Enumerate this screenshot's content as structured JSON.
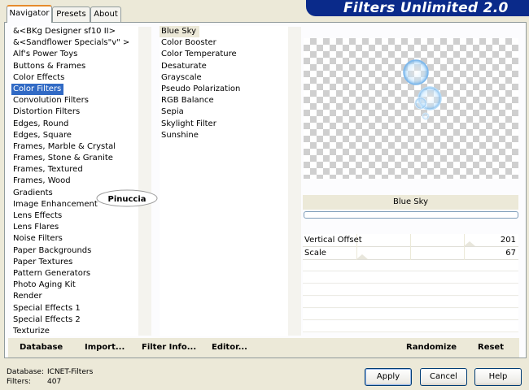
{
  "window": {
    "title": "Filters Unlimited 2.0"
  },
  "tabs": [
    {
      "label": "Navigator"
    },
    {
      "label": "Presets"
    },
    {
      "label": "About"
    }
  ],
  "categories": [
    "&<BKg Designer sf10 II>",
    "&<Sandflower Specials\"v\" >",
    "Alf's Power Toys",
    "Buttons & Frames",
    "Color Effects",
    "Color Filters",
    "Convolution Filters",
    "Distortion Filters",
    "Edges, Round",
    "Edges, Square",
    "Frames, Marble & Crystal",
    "Frames, Stone & Granite",
    "Frames, Textured",
    "Frames, Wood",
    "Gradients",
    "Image Enhancement",
    "Lens Effects",
    "Lens Flares",
    "Noise Filters",
    "Paper Backgrounds",
    "Paper Textures",
    "Pattern Generators",
    "Photo Aging Kit",
    "Render",
    "Special Effects 1",
    "Special Effects 2",
    "Texturize"
  ],
  "selected_category": "Color Filters",
  "filters": [
    "Blue Sky",
    "Color Booster",
    "Color Temperature",
    "Desaturate",
    "Grayscale",
    "Pseudo Polarization",
    "RGB Balance",
    "Sepia",
    "Skylight Filter",
    "Sunshine"
  ],
  "selected_filter": "Blue Sky",
  "watermark": "Pinuccia",
  "filter_title": "Blue Sky",
  "parameters": [
    {
      "label": "Vertical Offset",
      "value": "201",
      "level": 201
    },
    {
      "label": "Scale",
      "value": "67",
      "level": 67
    }
  ],
  "links": {
    "database": "Database",
    "import": "Import...",
    "filter_info": "Filter Info...",
    "editor": "Editor...",
    "randomize": "Randomize",
    "reset": "Reset"
  },
  "status": {
    "database_label": "Database:",
    "database_value": "ICNET-Filters",
    "filters_label": "Filters:",
    "filters_value": "407"
  },
  "buttons": {
    "apply": "Apply",
    "cancel": "Cancel",
    "help": "Help"
  }
}
